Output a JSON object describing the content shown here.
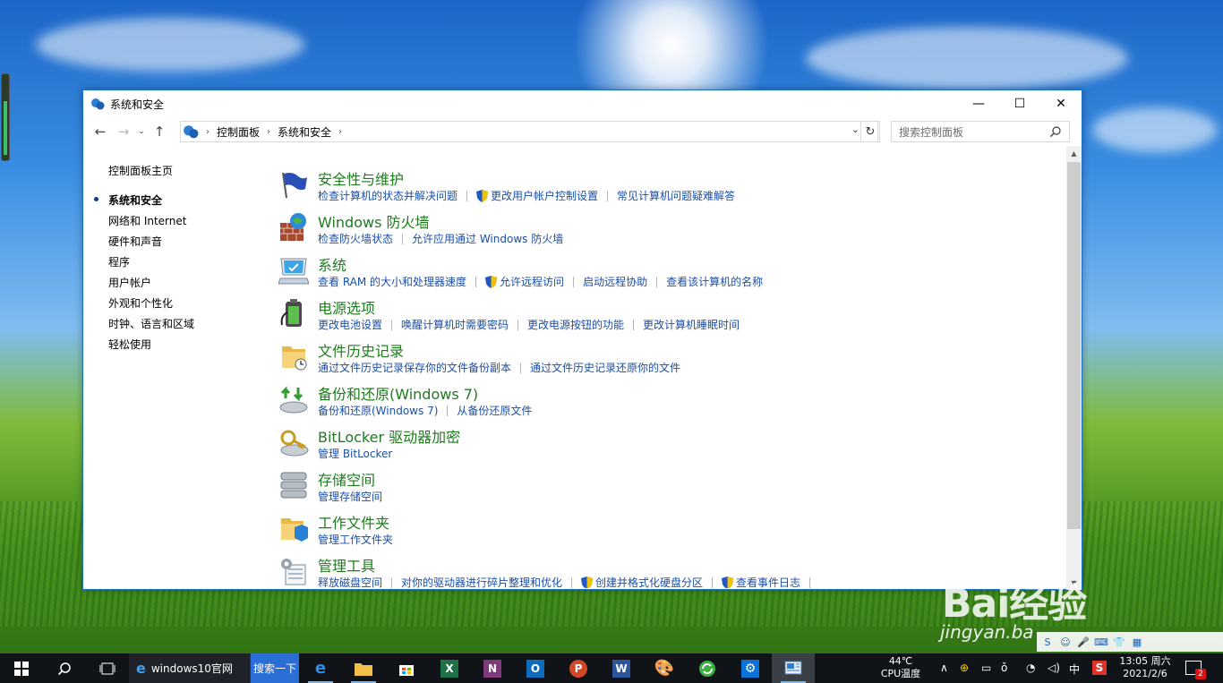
{
  "window": {
    "title": "系统和安全",
    "controls": {
      "minimize": "—",
      "maximize": "☐",
      "close": "✕"
    }
  },
  "address": {
    "crumbs": [
      "控制面板",
      "系统和安全"
    ],
    "search_placeholder": "搜索控制面板"
  },
  "sidebar": {
    "items": [
      {
        "label": "控制面板主页",
        "active": false
      },
      {
        "label": "系统和安全",
        "active": true
      },
      {
        "label": "网络和 Internet",
        "active": false
      },
      {
        "label": "硬件和声音",
        "active": false
      },
      {
        "label": "程序",
        "active": false
      },
      {
        "label": "用户帐户",
        "active": false
      },
      {
        "label": "外观和个性化",
        "active": false
      },
      {
        "label": "时钟、语言和区域",
        "active": false
      },
      {
        "label": "轻松使用",
        "active": false
      }
    ]
  },
  "categories": [
    {
      "title": "安全性与维护",
      "icon": "flag-icon",
      "links": [
        {
          "label": "检查计算机的状态并解决问题",
          "shield": false
        },
        {
          "label": "更改用户帐户控制设置",
          "shield": true
        },
        {
          "label": "常见计算机问题疑难解答",
          "shield": false
        }
      ]
    },
    {
      "title": "Windows 防火墙",
      "icon": "firewall-icon",
      "links": [
        {
          "label": "检查防火墙状态",
          "shield": false
        },
        {
          "label": "允许应用通过 Windows 防火墙",
          "shield": false
        }
      ]
    },
    {
      "title": "系统",
      "icon": "system-icon",
      "links": [
        {
          "label": "查看 RAM 的大小和处理器速度",
          "shield": false
        },
        {
          "label": "允许远程访问",
          "shield": true
        },
        {
          "label": "启动远程协助",
          "shield": false
        },
        {
          "label": "查看该计算机的名称",
          "shield": false
        }
      ]
    },
    {
      "title": "电源选项",
      "icon": "power-options-icon",
      "links": [
        {
          "label": "更改电池设置",
          "shield": false
        },
        {
          "label": "唤醒计算机时需要密码",
          "shield": false
        },
        {
          "label": "更改电源按钮的功能",
          "shield": false
        },
        {
          "label": "更改计算机睡眠时间",
          "shield": false
        }
      ]
    },
    {
      "title": "文件历史记录",
      "icon": "file-history-icon",
      "links": [
        {
          "label": "通过文件历史记录保存你的文件备份副本",
          "shield": false
        },
        {
          "label": "通过文件历史记录还原你的文件",
          "shield": false
        }
      ]
    },
    {
      "title": "备份和还原(Windows 7)",
      "icon": "backup-restore-icon",
      "links": [
        {
          "label": "备份和还原(Windows 7)",
          "shield": false
        },
        {
          "label": "从备份还原文件",
          "shield": false
        }
      ]
    },
    {
      "title": "BitLocker 驱动器加密",
      "icon": "bitlocker-icon",
      "links": [
        {
          "label": "管理 BitLocker",
          "shield": false
        }
      ]
    },
    {
      "title": "存储空间",
      "icon": "storage-spaces-icon",
      "links": [
        {
          "label": "管理存储空间",
          "shield": false
        }
      ]
    },
    {
      "title": "工作文件夹",
      "icon": "work-folders-icon",
      "links": [
        {
          "label": "管理工作文件夹",
          "shield": false
        }
      ]
    },
    {
      "title": "管理工具",
      "icon": "admin-tools-icon",
      "links": [
        {
          "label": "释放磁盘空间",
          "shield": false
        },
        {
          "label": "对你的驱动器进行碎片整理和优化",
          "shield": false
        },
        {
          "label": "创建并格式化硬盘分区",
          "shield": true
        },
        {
          "label": "查看事件日志",
          "shield": true
        }
      ]
    }
  ],
  "taskbar": {
    "ie_label": "windows10官网",
    "search_btn": "搜索一下",
    "temp_value": "44℃",
    "temp_label": "CPU温度",
    "ime": "中",
    "time": "13:05 周六",
    "date": "2021/2/6",
    "notif_count": "2"
  },
  "watermark": {
    "main": "Bai经验",
    "sub": "jingyan.ba"
  },
  "colors": {
    "category_title": "#1e7b1e",
    "link": "#1a4fa8",
    "accent": "#1a73c9"
  }
}
